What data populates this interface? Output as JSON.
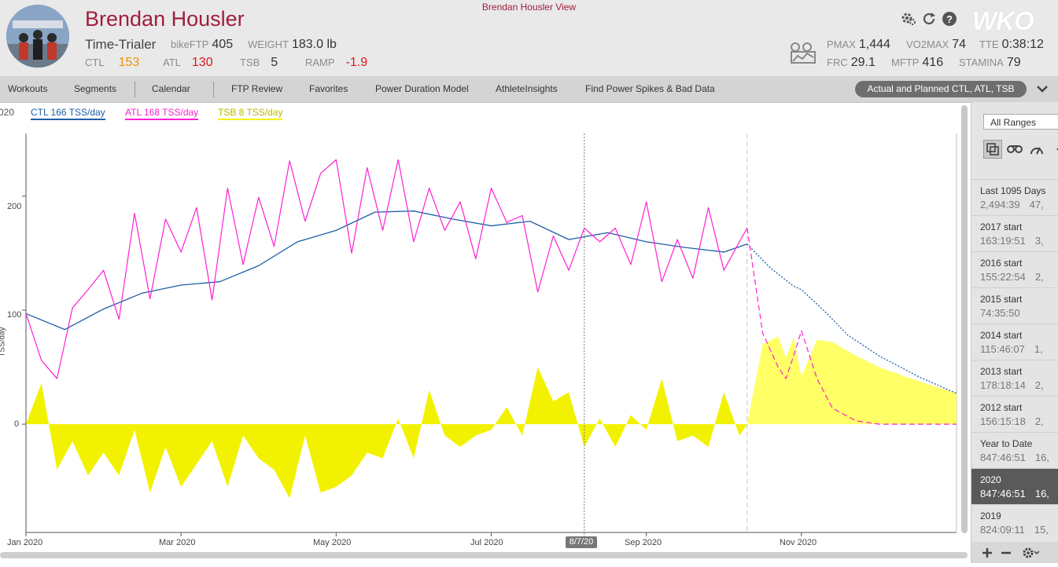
{
  "window": {
    "view_title": "Brendan Housler View"
  },
  "athlete": {
    "name": "Brendan Housler",
    "phenotype": "Time-Trialer",
    "metrics_left": [
      {
        "label": "bikeFTP",
        "value": "405"
      },
      {
        "label": "WEIGHT",
        "value": "183.0 lb"
      },
      {
        "label": "CTL",
        "value": "153"
      },
      {
        "label": "ATL",
        "value": "130"
      },
      {
        "label": "TSB",
        "value": "5"
      },
      {
        "label": "RAMP",
        "value": "-1.9"
      }
    ],
    "metrics_right": [
      {
        "label": "PMAX",
        "value": "1,444"
      },
      {
        "label": "VO2MAX",
        "value": "74"
      },
      {
        "label": "TTE",
        "value": "0:38:12"
      },
      {
        "label": "FRC",
        "value": "29.1"
      },
      {
        "label": "MFTP",
        "value": "416"
      },
      {
        "label": "STAMINA",
        "value": "79"
      }
    ]
  },
  "brand": {
    "logo_text": "WKO"
  },
  "header_icons": [
    "gears-icon",
    "refresh-icon",
    "help-icon"
  ],
  "nav": {
    "items": [
      "Workouts",
      "Segments",
      "Calendar",
      "FTP Review",
      "Favorites",
      "Power Duration Model",
      "AthleteInsights",
      "Find Power Spikes & Bad Data"
    ],
    "chart_selector": "Actual and Planned CTL, ATL, TSB"
  },
  "chart_data": {
    "type": "line",
    "legend": [
      {
        "label": "CTL  166 TSS/day",
        "color": "#1f5fa5"
      },
      {
        "label": "ATL  168 TSS/day",
        "color": "#ff1fd2"
      },
      {
        "label": "TSB  8 TSS/day",
        "color": "#f2f200"
      }
    ],
    "corner_fragment": "020",
    "y_axis_label": "TSS/day",
    "y_ticks": [
      "0",
      "100",
      "200"
    ],
    "ylim": [
      -95,
      255
    ],
    "x_ticks": [
      "Jan 2020",
      "Mar 2020",
      "May 2020",
      "Jul 2020",
      "Sep 2020",
      "Nov 2020"
    ],
    "x_tick_months": [
      0,
      2,
      4,
      6,
      8,
      10
    ],
    "xlim_months": [
      0,
      12
    ],
    "marker_label": "8/7/20",
    "marker_month": 7.2,
    "planned_start_month": 9.3,
    "series": [
      {
        "name": "CTL",
        "kind": "actual",
        "color": "#1f5fa5",
        "x": [
          0,
          0.5,
          1,
          1.5,
          2,
          2.5,
          3,
          3.5,
          4,
          4.5,
          5,
          5.5,
          6,
          6.5,
          7,
          7.5,
          8,
          8.5,
          9,
          9.3
        ],
        "y": [
          97,
          83,
          101,
          115,
          122,
          125,
          139,
          160,
          170,
          186,
          187,
          180,
          174,
          178,
          162,
          168,
          160,
          155,
          151,
          158
        ]
      },
      {
        "name": "CTL",
        "kind": "planned",
        "color": "#1f5fa5",
        "x": [
          9.3,
          9.6,
          9.9,
          10,
          10.3,
          10.6,
          11,
          11.5,
          12
        ],
        "y": [
          158,
          137,
          121,
          118,
          99,
          78,
          60,
          42,
          27
        ]
      },
      {
        "name": "ATL",
        "kind": "actual",
        "color": "#ff1fd2",
        "x": [
          0,
          0.2,
          0.4,
          0.6,
          0.8,
          1,
          1.2,
          1.4,
          1.6,
          1.8,
          2,
          2.2,
          2.4,
          2.6,
          2.8,
          3,
          3.2,
          3.4,
          3.6,
          3.8,
          4,
          4.2,
          4.4,
          4.6,
          4.8,
          5,
          5.2,
          5.4,
          5.6,
          5.8,
          6,
          6.2,
          6.4,
          6.6,
          6.8,
          7,
          7.2,
          7.4,
          7.6,
          7.8,
          8,
          8.2,
          8.4,
          8.6,
          8.8,
          9,
          9.2,
          9.3
        ],
        "y": [
          97,
          56,
          40,
          102,
          118,
          135,
          92,
          185,
          110,
          180,
          151,
          190,
          109,
          207,
          140,
          199,
          156,
          231,
          178,
          220,
          232,
          150,
          225,
          170,
          232,
          160,
          207,
          170,
          195,
          145,
          207,
          177,
          183,
          116,
          165,
          135,
          172,
          160,
          172,
          140,
          195,
          125,
          162,
          128,
          190,
          135,
          160,
          172
        ]
      },
      {
        "name": "ATL",
        "kind": "planned",
        "color": "#ff1fd2",
        "x": [
          9.3,
          9.5,
          9.7,
          9.8,
          9.9,
          10,
          10.2,
          10.4,
          10.7,
          11,
          11.5,
          12
        ],
        "y": [
          172,
          80,
          50,
          40,
          60,
          82,
          40,
          14,
          3,
          0,
          0,
          0
        ]
      },
      {
        "name": "TSB",
        "kind": "actual",
        "color": "#f2f200",
        "x": [
          0,
          0.2,
          0.4,
          0.6,
          0.8,
          1,
          1.2,
          1.4,
          1.6,
          1.8,
          2,
          2.2,
          2.4,
          2.6,
          2.8,
          3,
          3.2,
          3.4,
          3.6,
          3.8,
          4,
          4.2,
          4.4,
          4.6,
          4.8,
          5,
          5.2,
          5.4,
          5.6,
          5.8,
          6,
          6.2,
          6.4,
          6.6,
          6.8,
          7,
          7.2,
          7.4,
          7.6,
          7.8,
          8,
          8.2,
          8.4,
          8.6,
          8.8,
          9,
          9.2,
          9.3
        ],
        "y": [
          0,
          36,
          -40,
          -15,
          -45,
          -25,
          -45,
          -5,
          -60,
          -20,
          -55,
          -35,
          -15,
          -55,
          -10,
          -30,
          -40,
          -65,
          -10,
          -60,
          -55,
          -45,
          -25,
          -30,
          5,
          -30,
          30,
          -10,
          -20,
          -10,
          -5,
          15,
          -10,
          50,
          20,
          28,
          -20,
          5,
          -20,
          8,
          -5,
          40,
          -15,
          -10,
          -20,
          28,
          -10,
          0
        ]
      },
      {
        "name": "TSB",
        "kind": "planned",
        "color": "#f2f200",
        "x": [
          9.3,
          9.5,
          9.7,
          9.8,
          9.9,
          10,
          10.2,
          10.4,
          10.7,
          11,
          11.5,
          12
        ],
        "y": [
          0,
          70,
          77,
          58,
          76,
          42,
          74,
          72,
          60,
          50,
          38,
          27
        ]
      }
    ]
  },
  "sidebar": {
    "range_select": "All Ranges",
    "tools": [
      "overlay-icon",
      "bike-chain-icon",
      "performance-icon",
      "back-arrow-icon"
    ],
    "ranges": [
      {
        "name": "Last 1095 Days",
        "time": "2,494:39",
        "extra": "47,",
        "selected": false
      },
      {
        "name": "2017 start",
        "time": "163:19:51",
        "extra": "3,",
        "selected": false
      },
      {
        "name": "2016 start",
        "time": "155:22:54",
        "extra": "2,",
        "selected": false
      },
      {
        "name": "2015 start",
        "time": "74:35:50",
        "extra": "",
        "selected": false
      },
      {
        "name": "2014 start",
        "time": "115:46:07",
        "extra": "1,",
        "selected": false
      },
      {
        "name": "2013 start",
        "time": "178:18:14",
        "extra": "2,",
        "selected": false
      },
      {
        "name": "2012 start",
        "time": "156:15:18",
        "extra": "2,",
        "selected": false
      },
      {
        "name": "Year to Date",
        "time": "847:46:51",
        "extra": "16,",
        "selected": false
      },
      {
        "name": "2020",
        "time": "847:46:51",
        "extra": "16,",
        "selected": true
      },
      {
        "name": "2019",
        "time": "824:09:11",
        "extra": "15,",
        "selected": false
      }
    ],
    "footer_icons": [
      "plus-icon",
      "minus-icon",
      "settings-icon"
    ]
  }
}
